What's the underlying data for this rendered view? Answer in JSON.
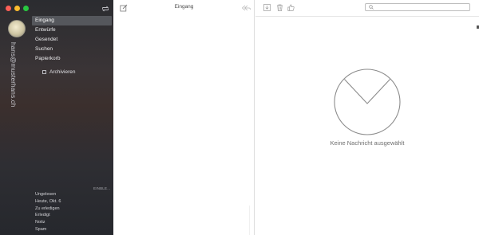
{
  "sidebar": {
    "account": "hans@musterhans.ch",
    "folders": [
      {
        "label": "Eingang",
        "active": true
      },
      {
        "label": "Entwürfe",
        "active": false
      },
      {
        "label": "Gesendet",
        "active": false
      },
      {
        "label": "Suchen",
        "active": false
      },
      {
        "label": "Papierkorb",
        "active": false
      }
    ],
    "archive_label": "Archivieren",
    "collapse_label": "EINBLE...",
    "smart_folders": [
      "Ungelesen",
      "Heute, Okt. 6",
      "Zu erledigen",
      "Erledigt",
      "Notiz",
      "Spam"
    ]
  },
  "message_list": {
    "title": "Eingang"
  },
  "detail": {
    "search_placeholder": "",
    "empty_state": "Keine Nachricht ausgewählt"
  },
  "colors": {
    "sidebar_bg": "#2e2e33",
    "active_folder_bg": "#55575c",
    "envelope_stroke": "#8c8c8c",
    "close": "#fc5f57",
    "minimize": "#fdbc2e",
    "zoom": "#28c840"
  },
  "icons": [
    "close-button",
    "minimize-button",
    "zoom-button",
    "sync-icon",
    "compose-icon",
    "reply-all-icon",
    "archive-icon",
    "trash-icon",
    "thumbs-up-icon",
    "search-icon",
    "envelope-icon",
    "folder-icon"
  ]
}
